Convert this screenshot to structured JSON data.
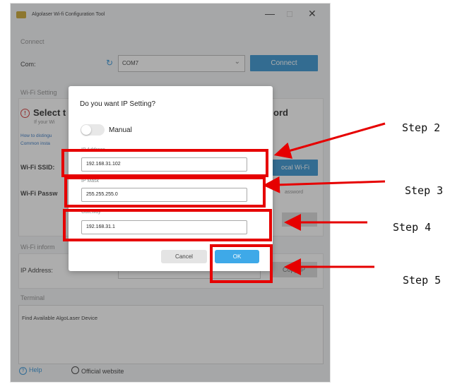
{
  "app": {
    "title": "Algolaser Wi-fi Configuration Tool",
    "window_controls": {
      "minimize": "—",
      "maximize": "☐",
      "close": "✕"
    }
  },
  "connect": {
    "section_label": "Connect",
    "com_label": "Com:",
    "com_value": "COM7",
    "connect_button": "Connect"
  },
  "wifi_settings": {
    "section_label": "Wi-Fi Setting",
    "select_text_left": "Select t",
    "select_text_right": "ord",
    "hint_text": "If your Wi",
    "link1": "How to distingu",
    "link2": "Common insta",
    "ssid_label": "Wi-Fi SSID:",
    "local_wifi_button": "ocal Wi-Fi",
    "password_label": "Wi-Fi Passw",
    "password_hint": "assword"
  },
  "wifi_info": {
    "section_label": "Wi-Fi inform",
    "ip_label": "IP Address:",
    "copy_ip_button": "Copy IP"
  },
  "terminal": {
    "section_label": "Terminal",
    "line": "Find Available AlgoLaser Device"
  },
  "footer": {
    "help": "Help",
    "official_website": "Official website"
  },
  "dialog": {
    "title": "Do you want IP Setting?",
    "toggle_label": "Manual",
    "ip_address_label": "IP Address",
    "ip_address_value": "192.168.31.102",
    "ip_mask_label": "IP Mask",
    "ip_mask_value": "255.255.255.0",
    "gateway_label": "Gateway",
    "gateway_value": "192.168.31.1",
    "cancel_button": "Cancel",
    "ok_button": "OK"
  },
  "annotations": {
    "step2": "Step 2",
    "step3": "Step 3",
    "step4": "Step 4",
    "step5": "Step 5",
    "color": "#e60000"
  }
}
